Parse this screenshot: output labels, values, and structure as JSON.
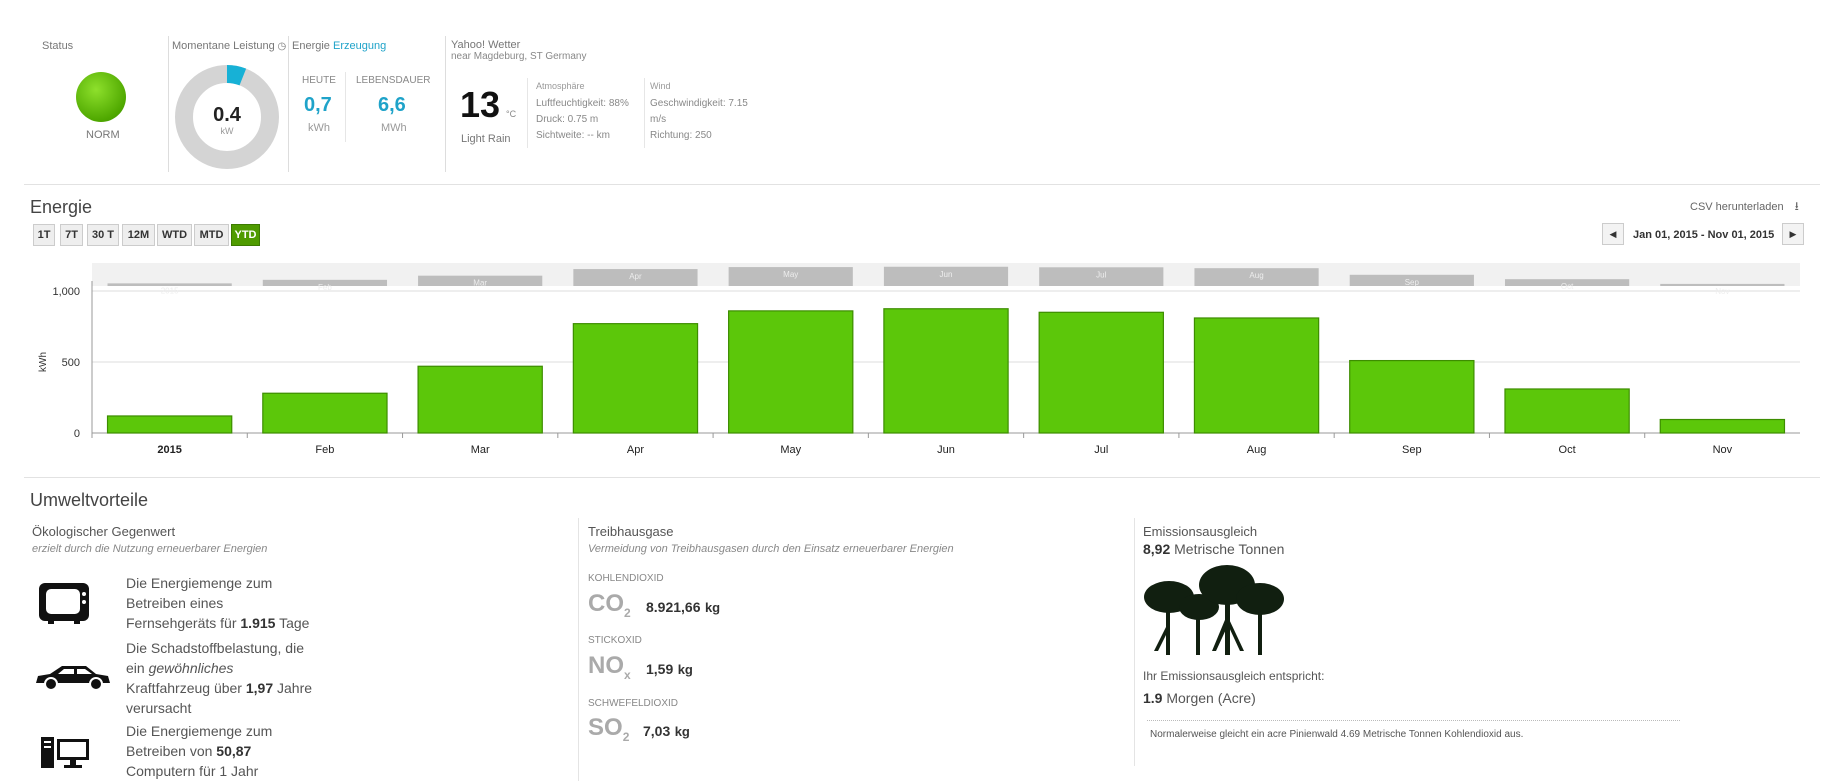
{
  "status": {
    "label": "Status",
    "value": "NORM",
    "color": "#5bbd00"
  },
  "power": {
    "label": "Momentane Leistung",
    "value": "0.4",
    "unit": "kW",
    "fraction": 0.06
  },
  "energy": {
    "label_prefix": "Energie",
    "label_link": "Erzeugung",
    "today": {
      "label": "HEUTE",
      "value": "0,7",
      "unit": "kWh"
    },
    "lifetime": {
      "label": "LEBENSDAUER",
      "value": "6,6",
      "unit": "MWh"
    }
  },
  "weather": {
    "source": "Yahoo! Wetter",
    "location": "near Magdeburg, ST Germany",
    "temp": "13",
    "temp_unit": "°C",
    "condition": "Light Rain",
    "atmosphere": {
      "title": "Atmosphäre",
      "humidity": "Luftfeuchtigkeit: 88%",
      "pressure": "Druck: 0.75 m",
      "visibility": "Sichtweite: -- km"
    },
    "wind": {
      "title": "Wind",
      "speed_line1": "Geschwindigkeit: 7.15",
      "speed_line2": "m/s",
      "direction": "Richtung: 250"
    }
  },
  "energie": {
    "title": "Energie",
    "csv_label": "CSV herunterladen",
    "date_range": "Jan 01, 2015 - Nov 01, 2015",
    "range_buttons": [
      "1T",
      "7T",
      "30 T",
      "12M",
      "WTD",
      "MTD",
      "YTD"
    ],
    "active_range": "YTD"
  },
  "chart_data": {
    "type": "bar",
    "categories": [
      "2015",
      "Feb",
      "Mar",
      "Apr",
      "May",
      "Jun",
      "Jul",
      "Aug",
      "Sep",
      "Oct",
      "Nov"
    ],
    "values": [
      120,
      280,
      470,
      770,
      860,
      875,
      850,
      810,
      510,
      310,
      95
    ],
    "ylabel": "kWh",
    "ylim": [
      0,
      1000
    ],
    "yticks": [
      "0",
      "500",
      "1,000"
    ],
    "navigator_labels": [
      "2015",
      "Feb",
      "Mar",
      "Apr",
      "May",
      "Jun",
      "Jul",
      "Aug",
      "Sep",
      "Oct",
      "Nov"
    ],
    "bar_color": "#5cc70a",
    "grid": true
  },
  "umwelt": {
    "title": "Umweltvorteile",
    "eco": {
      "title": "Ökologischer Gegenwert",
      "subtitle": "erzielt durch die Nutzung erneuerbarer Energien",
      "tv": {
        "l1": "Die Energiemenge zum",
        "l2": "Betreiben eines",
        "l3a": "Fernsehgeräts für ",
        "l3b": "1.915",
        "l3c": " Tage"
      },
      "car": {
        "l1": "Die Schadstoffbelastung, die",
        "l2a": "ein ",
        "l2b": "gewöhnliches",
        "l3a": "Kraftfahrzeug über ",
        "l3b": "1,97",
        "l3c": " Jahre",
        "l4": "verursacht"
      },
      "pc": {
        "l1": "Die Energiemenge zum",
        "l2a": "Betreiben von ",
        "l2b": "50,87",
        "l3": "Computern für 1 Jahr"
      }
    },
    "ghg": {
      "title": "Treibhausgase",
      "subtitle": "Vermeidung von Treibhausgasen durch den Einsatz erneuerbarer Energien",
      "co2": {
        "caption": "KOHLENDIOXID",
        "formula": "CO",
        "sub": "2",
        "value": "8.921,66",
        "unit": "kg"
      },
      "nox": {
        "caption": "STICKOXID",
        "formula": "NO",
        "sub": "x",
        "value": "1,59",
        "unit": "kg"
      },
      "so2": {
        "caption": "SCHWEFELDIOXID",
        "formula": "SO",
        "sub": "2",
        "value": "7,03",
        "unit": "kg"
      }
    },
    "emission": {
      "title": "Emissionsausgleich",
      "amount": "8,92",
      "amount_unit": "Metrische Tonnen",
      "equiv_label": "Ihr Emissionsausgleich entspricht:",
      "acre_value": "1.9",
      "acre_unit": "Morgen (Acre)",
      "note": "Normalerweise gleicht ein acre Pinienwald 4.69 Metrische Tonnen Kohlendioxid aus."
    }
  }
}
